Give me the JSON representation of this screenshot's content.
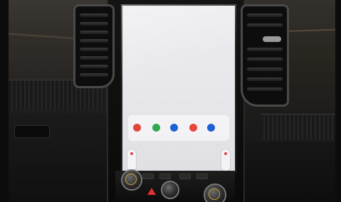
{
  "photo": {
    "subject": "vehicle-center-console",
    "screen": {
      "dock_apps": [
        {
          "icon": "phone-red-icon",
          "color": "#e0453a"
        },
        {
          "icon": "phone-icon",
          "color": "#2fa84f"
        },
        {
          "icon": "navigation-icon",
          "color": "#1a62d6"
        },
        {
          "icon": "music-icon",
          "color": "#e8443c"
        },
        {
          "icon": "app-icon",
          "color": "#1e60d8"
        }
      ]
    },
    "controls": {
      "hazard_color": "#e03131",
      "knob_accent": "#c9a23a"
    }
  }
}
